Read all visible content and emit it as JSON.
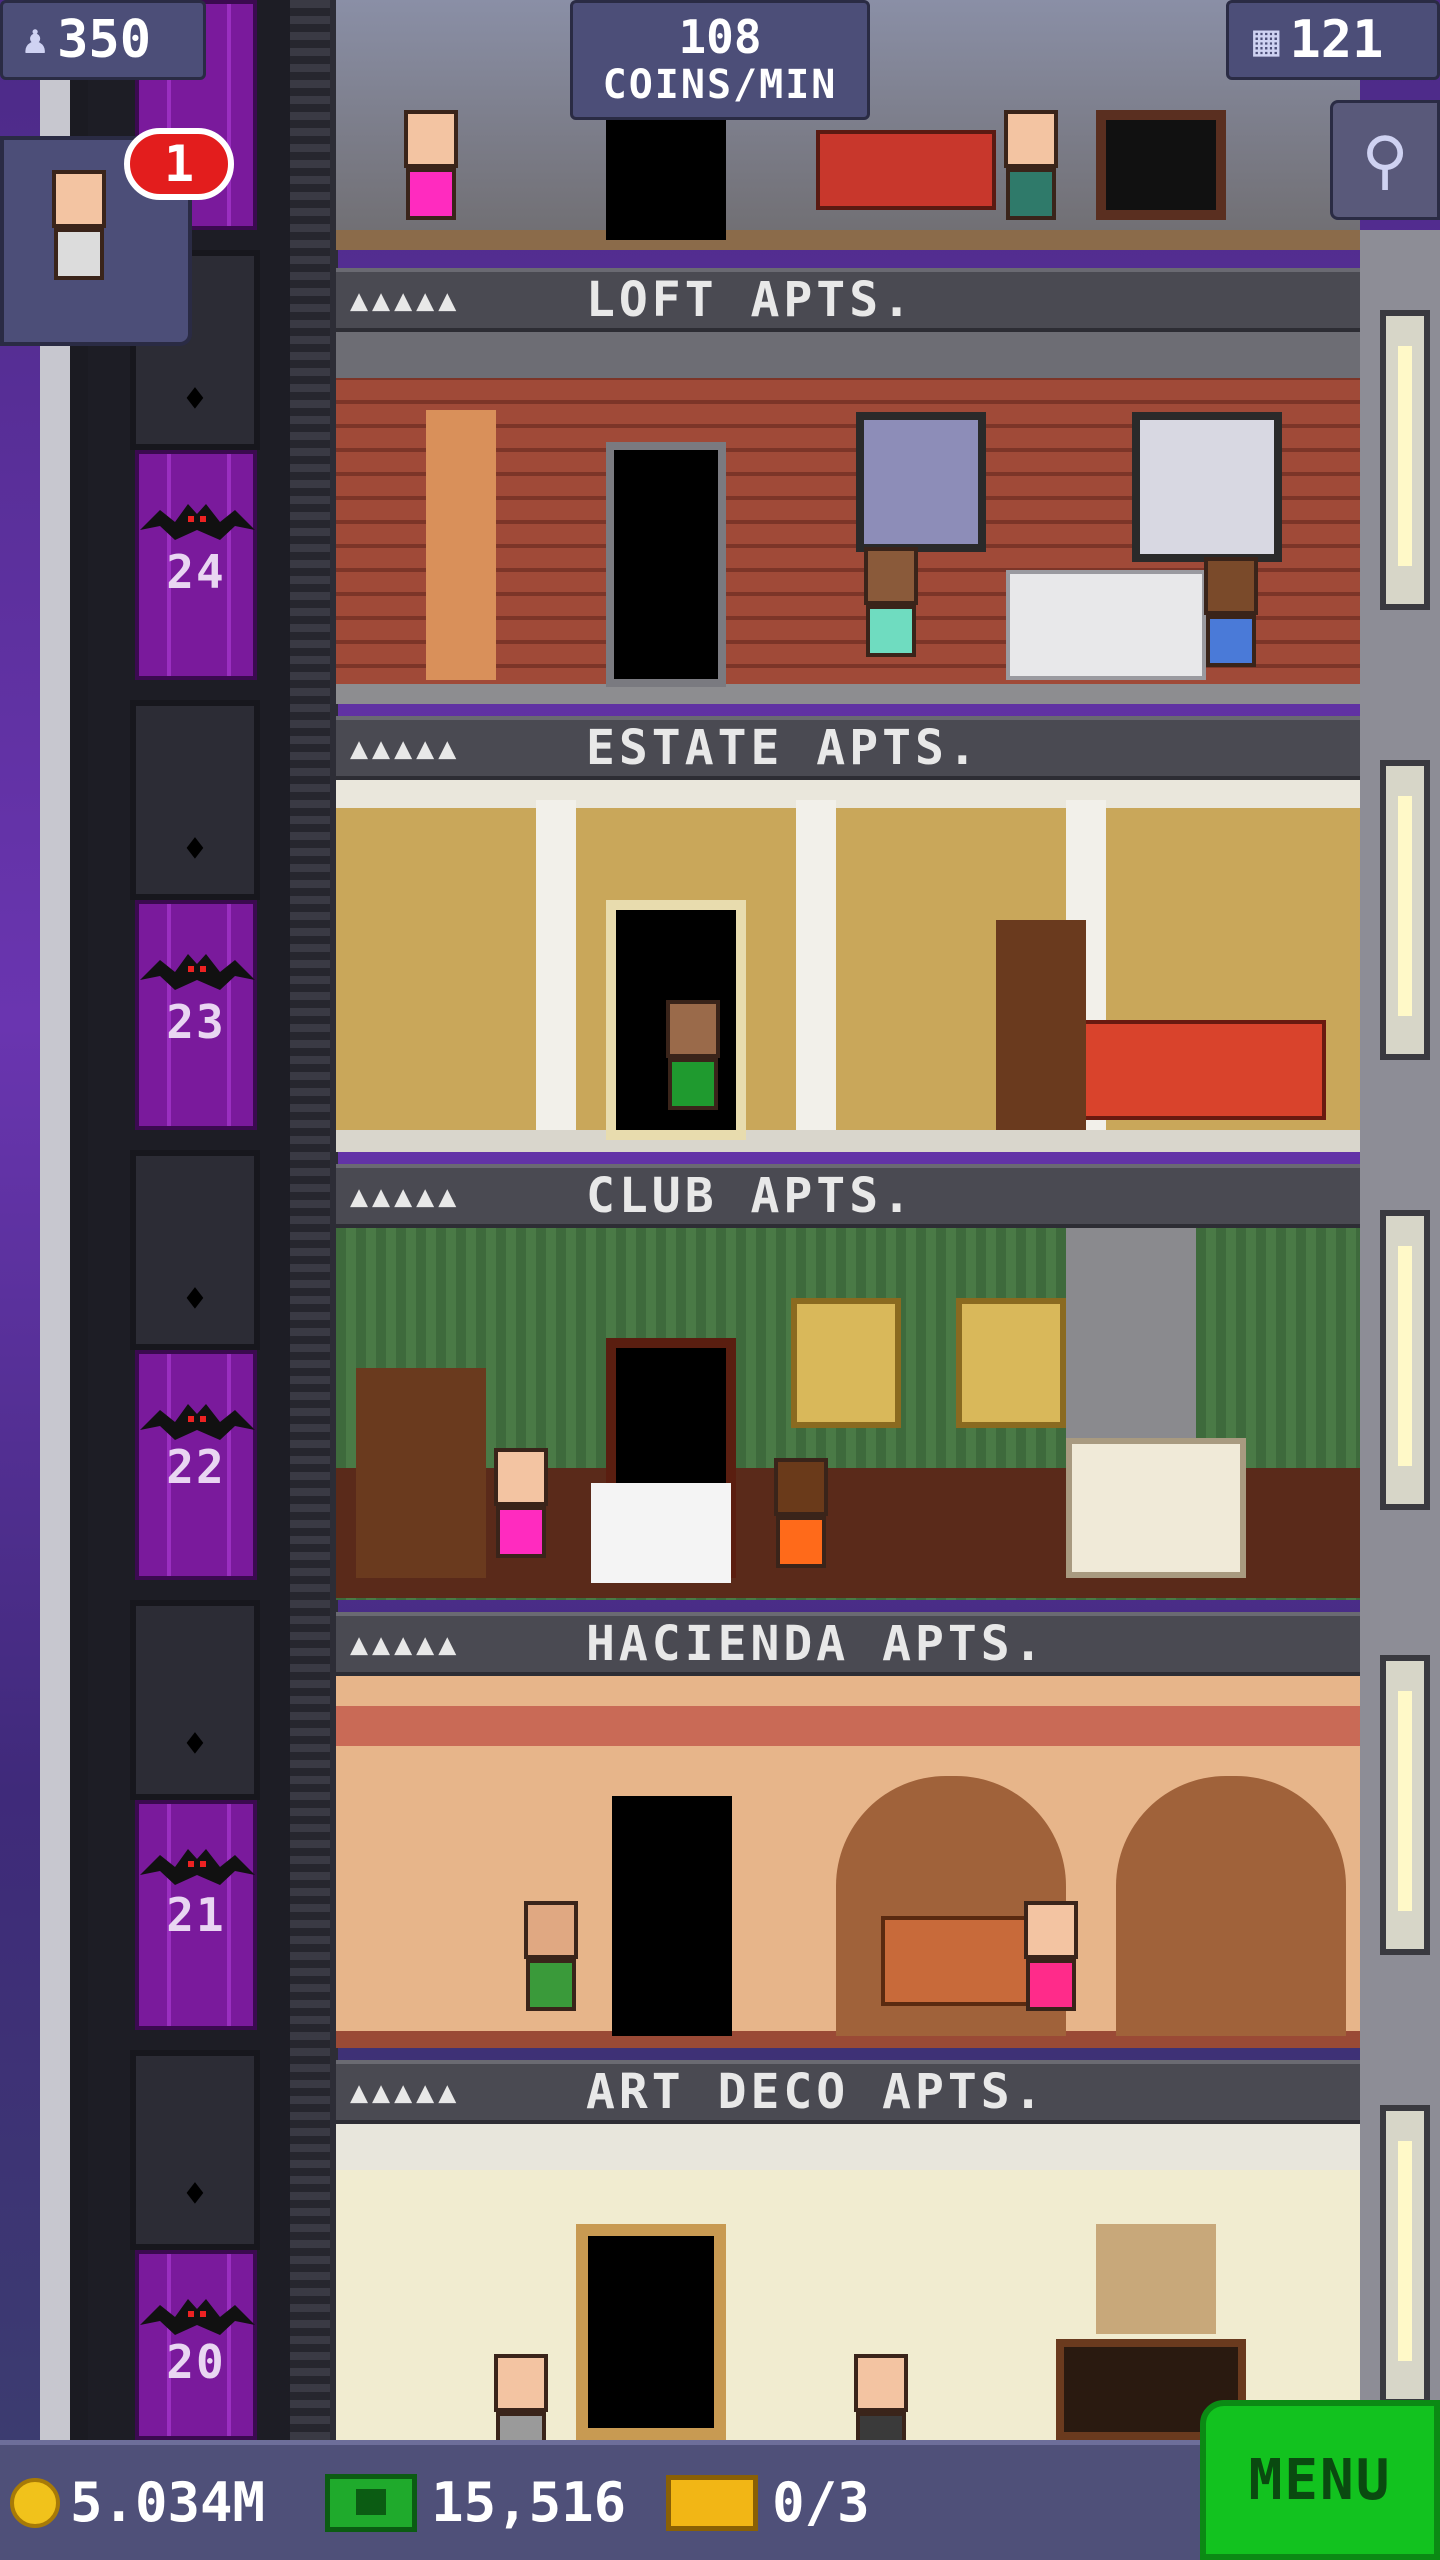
{
  "hud": {
    "population": "350",
    "coins_per_min": "108",
    "coins_per_min_label": "COINS/MIN",
    "floor_count": "121",
    "visitor_badge": "1"
  },
  "floors": [
    {
      "number": "24",
      "name": "LOFT APTS.",
      "stars": "▲▲▲▲▲"
    },
    {
      "number": "23",
      "name": "ESTATE APTS.",
      "stars": "▲▲▲▲▲"
    },
    {
      "number": "22",
      "name": "CLUB APTS.",
      "stars": "▲▲▲▲▲"
    },
    {
      "number": "21",
      "name": "HACIENDA APTS.",
      "stars": "▲▲▲▲▲"
    },
    {
      "number": "20",
      "name": "ART DECO APTS.",
      "stars": "▲▲▲▲▲"
    }
  ],
  "bottom": {
    "coins": "5.034M",
    "bux": "15,516",
    "tickets": "0/3",
    "menu_label": "MENU"
  },
  "colors": {
    "elevator_door": "#7a1a9c",
    "menu_button": "#12c21f",
    "hud_panel": "#4c4e78"
  }
}
